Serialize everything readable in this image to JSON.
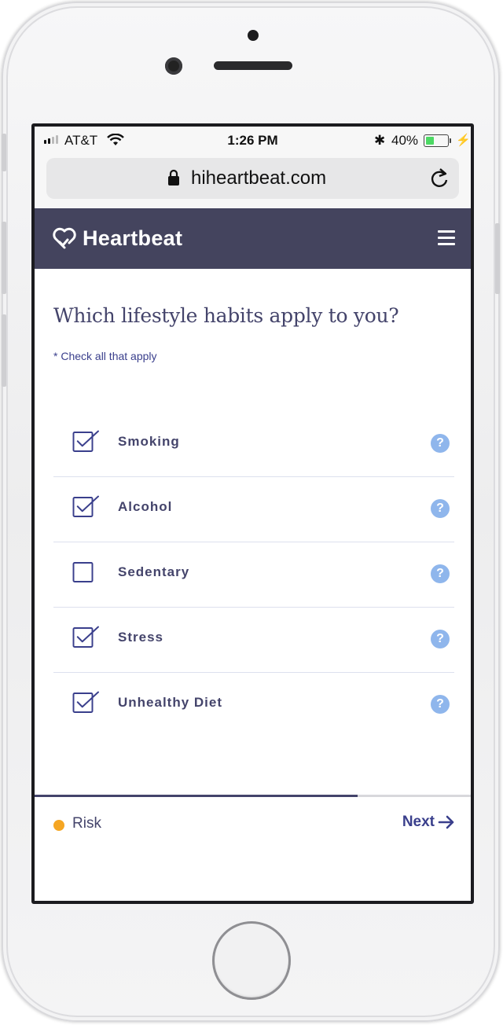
{
  "status_bar": {
    "carrier": "AT&T",
    "time": "1:26 PM",
    "battery_percent": "40%",
    "battery_level": 0.4,
    "bluetooth_glyph": "✱",
    "charging_glyph": "⚡"
  },
  "browser": {
    "url": "hiheartbeat.com"
  },
  "header": {
    "brand": "Heartbeat",
    "color": "#44445e"
  },
  "question": {
    "title": "Which lifestyle habits apply to you?",
    "hint": "* Check all that apply"
  },
  "options": [
    {
      "label": "Smoking",
      "checked": true,
      "help": "?"
    },
    {
      "label": "Alcohol",
      "checked": true,
      "help": "?"
    },
    {
      "label": "Sedentary",
      "checked": false,
      "help": "?"
    },
    {
      "label": "Stress",
      "checked": true,
      "help": "?"
    },
    {
      "label": "Unhealthy Diet",
      "checked": true,
      "help": "?"
    }
  ],
  "footer": {
    "step_label": "Risk",
    "step_dot_color": "#f5a623",
    "next_label": "Next",
    "progress": 0.74
  },
  "colors": {
    "accent": "#3a3f8c",
    "help": "#8fb6ec"
  }
}
